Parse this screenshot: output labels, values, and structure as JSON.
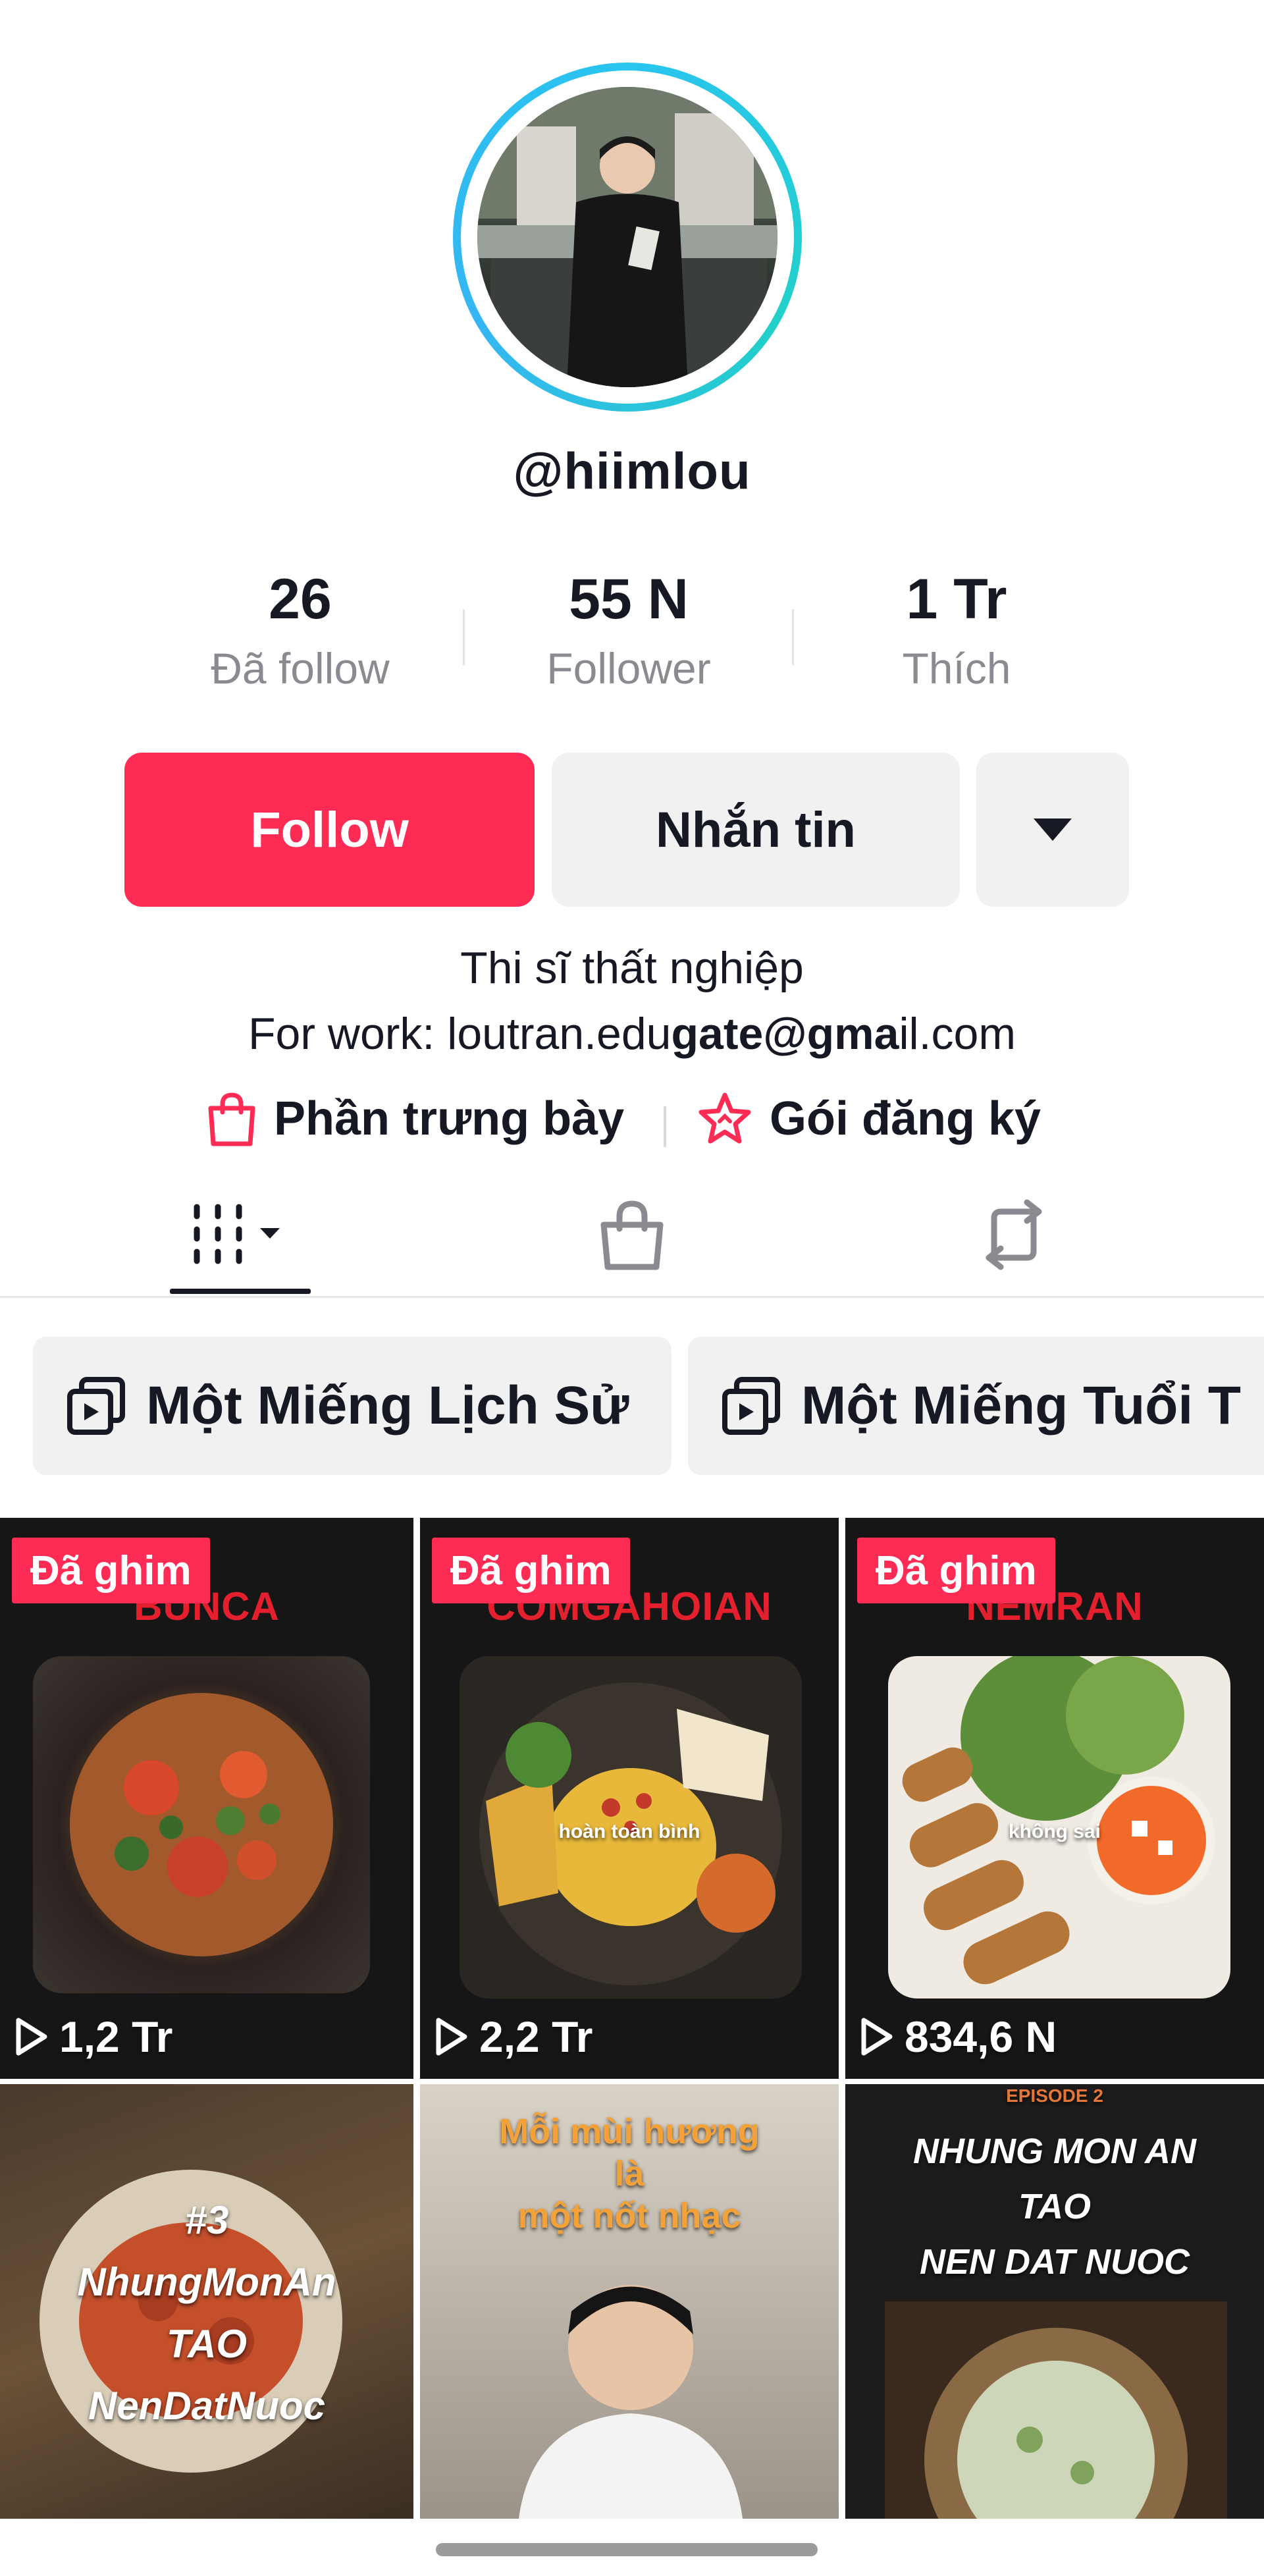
{
  "profile": {
    "username": "@hiimlou",
    "avatar_alt": "avatar"
  },
  "stats": [
    {
      "value": "26",
      "label": "Đã follow"
    },
    {
      "value": "55 N",
      "label": "Follower"
    },
    {
      "value": "1 Tr",
      "label": "Thích"
    }
  ],
  "actions": {
    "follow_label": "Follow",
    "message_label": "Nhắn tin",
    "more_icon": "caret-down-icon"
  },
  "bio": {
    "line1": "Thi sĩ thất nghiệp",
    "line2_prefix": "For work: loutran.edu",
    "line2_bold": "gate@gma",
    "line2_suffix": "il.com"
  },
  "links": [
    {
      "label": "Phần trưng bày",
      "icon": "shopping-bag-icon"
    },
    {
      "label": "Gói đăng ký",
      "icon": "star-badge-icon"
    }
  ],
  "tabs": [
    {
      "name": "videos",
      "icon": "grid-icon"
    },
    {
      "name": "shop",
      "icon": "shopping-bag-icon"
    },
    {
      "name": "reposts",
      "icon": "repost-icon"
    }
  ],
  "playlists": [
    {
      "label": "Một Miếng Lịch Sử"
    },
    {
      "label": "Một Miếng Tuổi T"
    }
  ],
  "videos": [
    {
      "pinned_label": "Đã ghim",
      "title": "BUNCA",
      "views": "1,2 Tr"
    },
    {
      "pinned_label": "Đã ghim",
      "title": "COMGAHOIAN",
      "views": "2,2 Tr",
      "caption": "hoàn toàn bình"
    },
    {
      "pinned_label": "Đã ghim",
      "title": "NEMRAN",
      "views": "834,6 N",
      "caption": "không sai"
    },
    {
      "text_lines": [
        "#3",
        "NhungMonAn",
        "TAO",
        "NenDatNuoc"
      ]
    },
    {
      "text_lines": [
        "Mỗi mùi hương",
        "là",
        "một nốt nhạc"
      ]
    },
    {
      "episode": "EPISODE 2",
      "text_lines": [
        "NHUNG MON AN",
        "TAO",
        "NEN DAT NUOC"
      ]
    }
  ],
  "colors": {
    "accent": "#fe2c55",
    "ring": "#29c4f0",
    "text": "#161823",
    "muted": "#8a8b91",
    "button_bg": "#f1f1f2"
  }
}
